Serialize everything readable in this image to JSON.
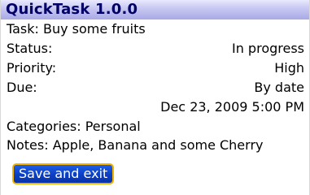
{
  "app": {
    "title": "QuickTask 1.0.0"
  },
  "task": {
    "task_line": "Task: Buy some fruits",
    "status_label": "Status:",
    "status_value": "In progress",
    "priority_label": "Priority:",
    "priority_value": "High",
    "due_label": "Due:",
    "due_value": "By date",
    "due_datetime": "Dec 23, 2009 5:00 PM",
    "categories_line": "Categories: Personal",
    "notes_line": "Notes: Apple, Banana and some Cherry"
  },
  "actions": {
    "save_label": "Save and exit"
  },
  "colors": {
    "title_text": "#000066",
    "title_bar_gradient": [
      "#e9e9ff",
      "#a9a9e6"
    ],
    "button_bg": "#0b3fc4",
    "button_border": "#f3b400"
  }
}
